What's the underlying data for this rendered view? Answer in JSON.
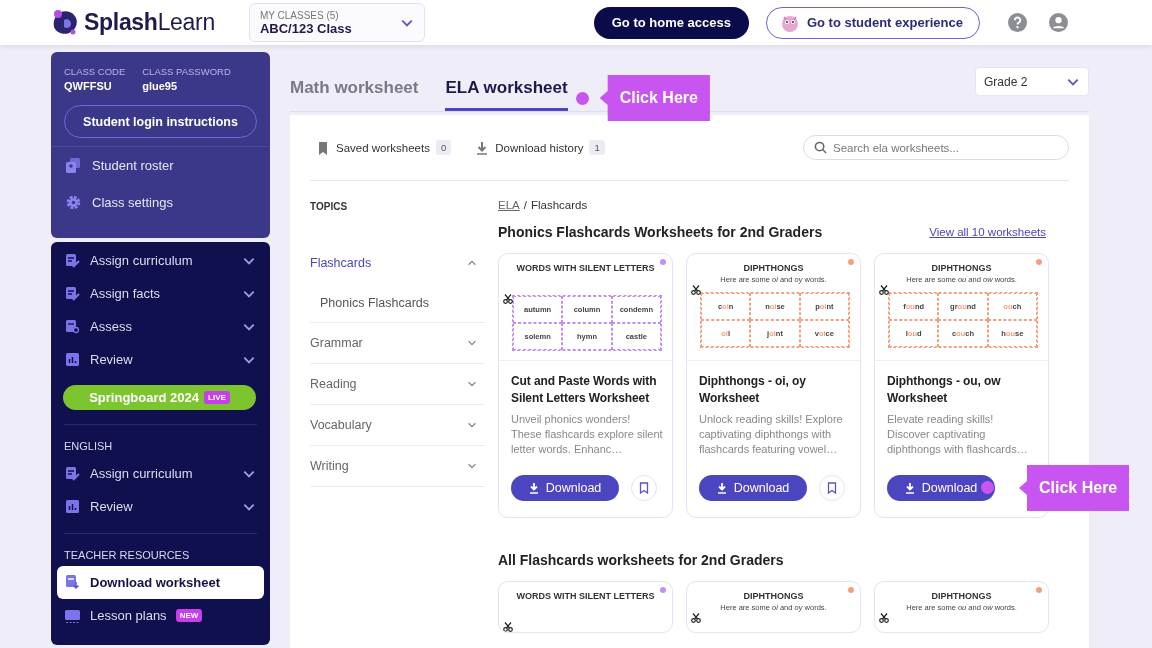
{
  "header": {
    "logo": "**Splash**Learn",
    "class_picker": {
      "label": "MY CLASSES (5)",
      "value": "ABC/123 Class"
    },
    "buttons": [
      {
        "label": "Go to home access",
        "kind": "solid"
      },
      {
        "label": "Go to student experience",
        "kind": "outline"
      }
    ]
  },
  "class_panel": {
    "code": {
      "label": "CLASS CODE",
      "value": "QWFFSU"
    },
    "password": {
      "label": "CLASS PASSWORD",
      "value": "glue95"
    },
    "login_button": "Student login instructions",
    "links": [
      {
        "label": "Student roster"
      },
      {
        "label": "Class settings"
      }
    ]
  },
  "nav": [
    {
      "kind": "item",
      "label": "Assign curriculum",
      "has_submenu": true,
      "selected": false
    },
    {
      "kind": "item",
      "label": "Assign facts",
      "has_submenu": true,
      "selected": false
    },
    {
      "kind": "item",
      "label": "Assess",
      "has_submenu": true,
      "selected": false
    },
    {
      "kind": "item",
      "label": "Review",
      "has_submenu": true,
      "selected": false
    },
    {
      "kind": "promo",
      "label": "Springboard 2024",
      "badge": "LIVE"
    },
    {
      "kind": "heading",
      "label": "ENGLISH"
    },
    {
      "kind": "item",
      "label": "Assign curriculum",
      "has_submenu": true,
      "selected": false
    },
    {
      "kind": "item",
      "label": "Review",
      "has_submenu": true,
      "selected": false
    },
    {
      "kind": "heading",
      "label": "TEACHER RESOURCES"
    },
    {
      "kind": "item",
      "label": "Download worksheet",
      "has_submenu": false,
      "selected": true
    },
    {
      "kind": "item",
      "label": "Lesson plans",
      "has_submenu": false,
      "selected": false,
      "badge": "NEW"
    }
  ],
  "tabs": [
    {
      "label": "Math worksheet",
      "selected": false
    },
    {
      "label": "ELA worksheet",
      "selected": true,
      "callout": "Click Here"
    }
  ],
  "grade_picker": {
    "value": "Grade 2"
  },
  "toolbar": {
    "links": [
      {
        "label": "Saved worksheets",
        "count": "0"
      },
      {
        "label": "Download history",
        "count": "1"
      }
    ],
    "search": {
      "placeholder": "Search ela worksheets..."
    }
  },
  "topics": {
    "heading": "TOPICS",
    "items": [
      {
        "label": "Flashcards",
        "selected": true,
        "expanded": true,
        "children": [
          {
            "label": "Phonics Flashcards"
          }
        ]
      },
      {
        "label": "Grammar",
        "selected": false,
        "expanded": false
      },
      {
        "label": "Reading",
        "selected": false,
        "expanded": false
      },
      {
        "label": "Vocabulary",
        "selected": false,
        "expanded": false
      },
      {
        "label": "Writing",
        "selected": false,
        "expanded": false
      }
    ]
  },
  "breadcrumb": {
    "items": [
      "ELA",
      "Flashcards"
    ],
    "separator": "/"
  },
  "featured": {
    "title": "Phonics Flashcards Worksheets for 2nd Graders",
    "view_all": "View all 10 worksheets",
    "cards": [
      {
        "color": "#c58cf2",
        "title": "Cut and Paste Words with Silent Letters Worksheet",
        "description": "Unveil phonics wonders! These flashcards explore silent letter words. Enhanc…",
        "download": "Download",
        "saved": false,
        "preview": {
          "heading": "WORDS WITH SILENT LETTERS",
          "words": [
            "autumn",
            "column",
            "condemn",
            "solemn",
            "hymn",
            "castle"
          ]
        }
      },
      {
        "color": "#f4a07c",
        "title": "Diphthongs - oi, oy Worksheet",
        "description": "Unlock reading skills! Explore captivating diphthongs with flashcards featuring vowel…",
        "download": "Download",
        "saved": false,
        "preview": {
          "heading": "DIPHTHONGS",
          "subheading": "Here are some *oi* and *oy* words.",
          "words": [
            "c**oi**n",
            "n**oi**se",
            "p**oi**nt",
            "**oi**l",
            "j**oi**nt",
            "v**oi**ce"
          ]
        }
      },
      {
        "color": "#f4a07c",
        "title": "Diphthongs - ou, ow Worksheet",
        "description": "Elevate reading skills! Discover captivating diphthongs with flashcards…",
        "download": "Download",
        "callout": "Click Here",
        "preview": {
          "heading": "DIPHTHONGS",
          "subheading": "Here are some *ou* and *ow* words.",
          "words": [
            "f**ou**nd",
            "gr**ou**nd",
            "**ou**ch",
            "l**ou**d",
            "c**ou**ch",
            "h**ou**se"
          ]
        }
      }
    ]
  },
  "all_worksheets": {
    "title": "All Flashcards worksheets for 2nd Graders",
    "cards": [
      {
        "color": "#c58cf2",
        "preview": {
          "heading": "WORDS WITH SILENT LETTERS"
        }
      },
      {
        "color": "#f4a07c",
        "preview": {
          "heading": "DIPHTHONGS",
          "subheading": "Here are some *oi* and *oy* words."
        }
      },
      {
        "color": "#f4a07c",
        "preview": {
          "heading": "DIPHTHONGS",
          "subheading": "Here are some *ou* and *ow* words."
        }
      }
    ]
  }
}
